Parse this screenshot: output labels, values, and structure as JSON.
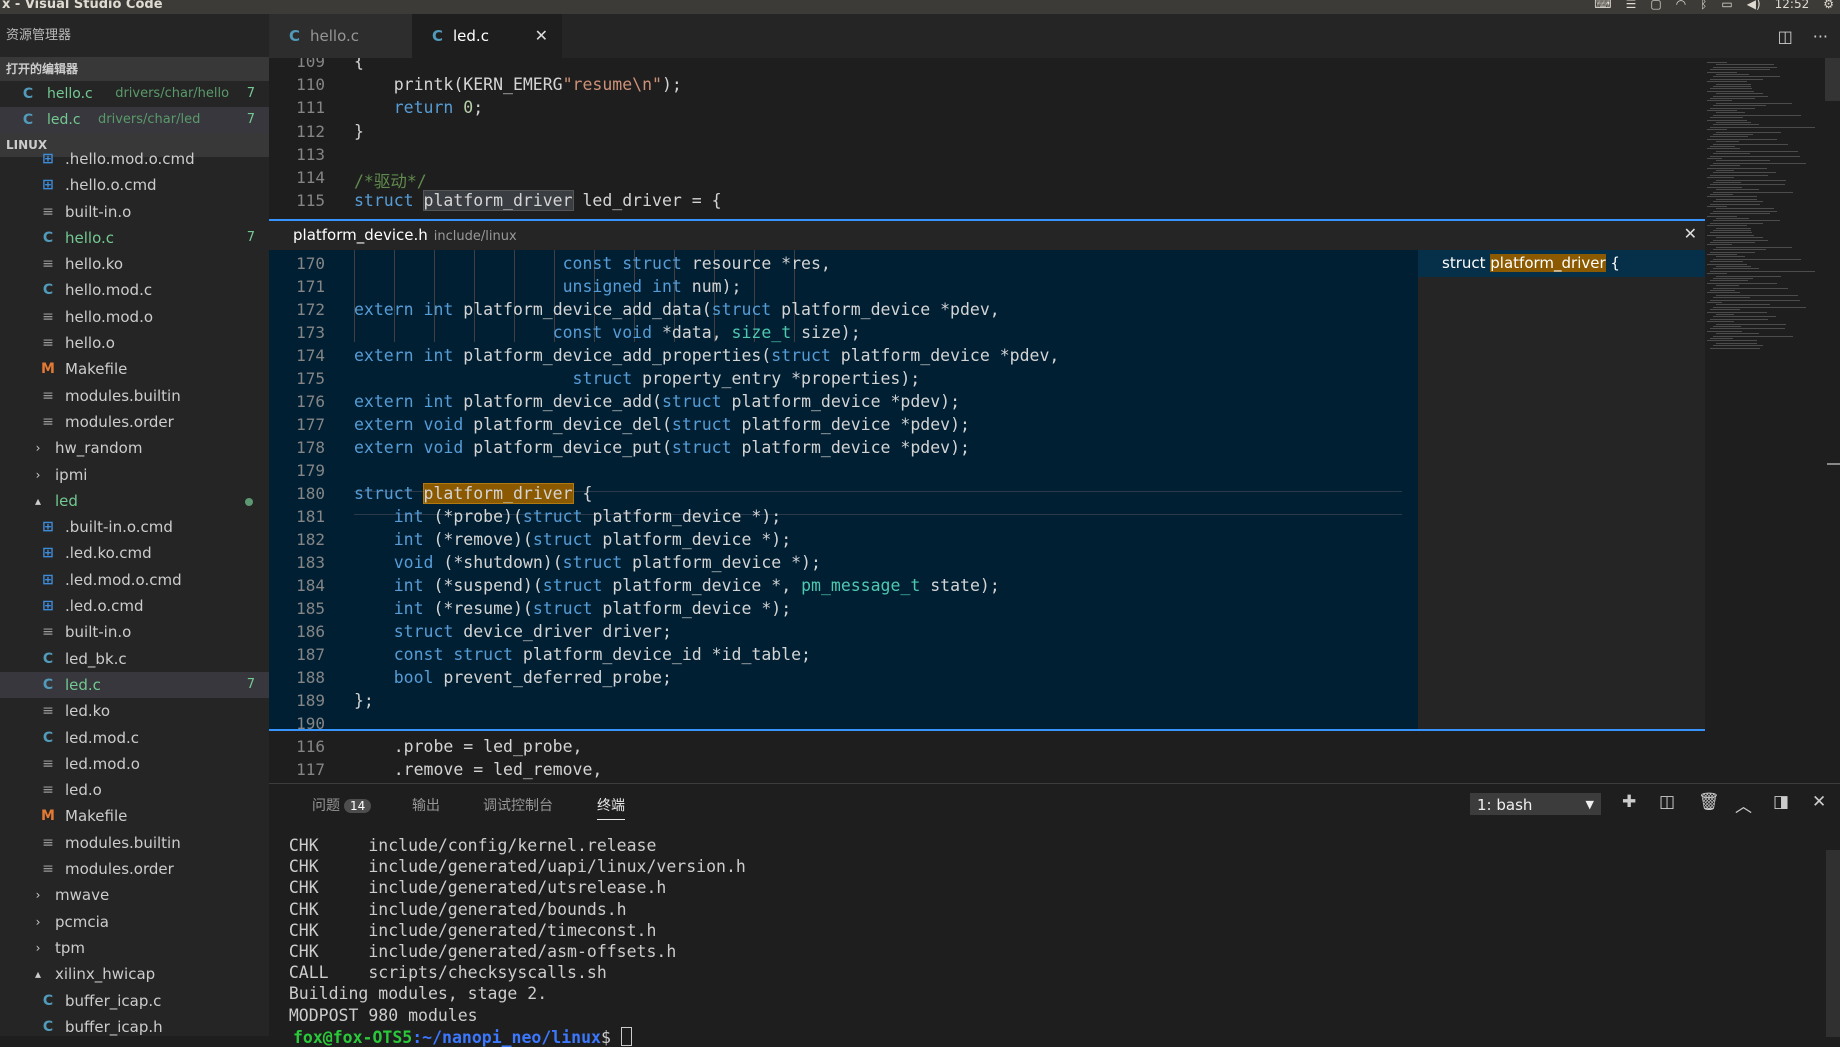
{
  "window": {
    "title": "x - Visual Studio Code",
    "clock": "12:52"
  },
  "sidebar": {
    "title": "资源管理器",
    "open_editors_label": "打开的编辑器",
    "open_editors": [
      {
        "icon": "C",
        "name": "hello.c",
        "path": "drivers/char/hello",
        "badge": "7"
      },
      {
        "icon": "C",
        "name": "led.c",
        "path": "drivers/char/led",
        "badge": "7"
      }
    ],
    "workspace_label": "LINUX",
    "tree": [
      {
        "icon": "win",
        "name": ".hello.mod.o.cmd",
        "indent": 2
      },
      {
        "icon": "win",
        "name": ".hello.o.cmd",
        "indent": 2
      },
      {
        "icon": "≡",
        "name": "built-in.o",
        "indent": 2
      },
      {
        "icon": "C",
        "name": "hello.c",
        "indent": 2,
        "badge": "7",
        "modified": true
      },
      {
        "icon": "≡",
        "name": "hello.ko",
        "indent": 2
      },
      {
        "icon": "C",
        "name": "hello.mod.c",
        "indent": 2
      },
      {
        "icon": "≡",
        "name": "hello.mod.o",
        "indent": 2
      },
      {
        "icon": "≡",
        "name": "hello.o",
        "indent": 2
      },
      {
        "icon": "M",
        "name": "Makefile",
        "indent": 2
      },
      {
        "icon": "≡",
        "name": "modules.builtin",
        "indent": 2
      },
      {
        "icon": "≡",
        "name": "modules.order",
        "indent": 2
      },
      {
        "icon": "›",
        "name": "hw_random",
        "indent": 1
      },
      {
        "icon": "›",
        "name": "ipmi",
        "indent": 1
      },
      {
        "icon": "⌄",
        "name": "led",
        "indent": 1,
        "modified": true,
        "dot": true
      },
      {
        "icon": "win",
        "name": ".built-in.o.cmd",
        "indent": 2
      },
      {
        "icon": "win",
        "name": ".led.ko.cmd",
        "indent": 2
      },
      {
        "icon": "win",
        "name": ".led.mod.o.cmd",
        "indent": 2
      },
      {
        "icon": "win",
        "name": ".led.o.cmd",
        "indent": 2
      },
      {
        "icon": "≡",
        "name": "built-in.o",
        "indent": 2
      },
      {
        "icon": "C",
        "name": "led_bk.c",
        "indent": 2
      },
      {
        "icon": "C",
        "name": "led.c",
        "indent": 2,
        "badge": "7",
        "modified": true,
        "selected": true
      },
      {
        "icon": "≡",
        "name": "led.ko",
        "indent": 2
      },
      {
        "icon": "C",
        "name": "led.mod.c",
        "indent": 2
      },
      {
        "icon": "≡",
        "name": "led.mod.o",
        "indent": 2
      },
      {
        "icon": "≡",
        "name": "led.o",
        "indent": 2
      },
      {
        "icon": "M",
        "name": "Makefile",
        "indent": 2
      },
      {
        "icon": "≡",
        "name": "modules.builtin",
        "indent": 2
      },
      {
        "icon": "≡",
        "name": "modules.order",
        "indent": 2
      },
      {
        "icon": "›",
        "name": "mwave",
        "indent": 1
      },
      {
        "icon": "›",
        "name": "pcmcia",
        "indent": 1
      },
      {
        "icon": "›",
        "name": "tpm",
        "indent": 1
      },
      {
        "icon": "⌄",
        "name": "xilinx_hwicap",
        "indent": 1
      },
      {
        "icon": "C",
        "name": "buffer_icap.c",
        "indent": 2
      },
      {
        "icon": "C",
        "name": "buffer_icap.h",
        "indent": 2
      }
    ]
  },
  "tabs": [
    {
      "label": "hello.c",
      "active": false
    },
    {
      "label": "led.c",
      "active": true
    }
  ],
  "editor": {
    "lines_top": [
      {
        "n": "109",
        "html": "{"
      },
      {
        "n": "110",
        "html": "    printk(KERN_EMERG<span class=\"str\">\"resume\\n\"</span>);"
      },
      {
        "n": "111",
        "html": "    <span class=\"kw\">return</span> <span class=\"num\">0</span>;"
      },
      {
        "n": "112",
        "html": "}"
      },
      {
        "n": "113",
        "html": ""
      },
      {
        "n": "114",
        "html": "<span class=\"cm\">/*驱动*/</span>"
      },
      {
        "n": "115",
        "html": "<span class=\"kw\">struct</span> <span class=\"hl\">platform_driver</span> led_driver = {"
      }
    ],
    "lines_bottom": [
      {
        "n": "116",
        "html": "    .probe = led_probe,"
      },
      {
        "n": "117",
        "html": "    .remove = led_remove,"
      }
    ]
  },
  "peek": {
    "file": "platform_device.h",
    "path": "include/linux",
    "reference": {
      "prefix": "struct ",
      "name": "platform_driver",
      "suffix": " {"
    },
    "lines": [
      {
        "n": "170",
        "html": "                     <span class=\"kw\">const</span> <span class=\"kw\">struct</span> resource *res,"
      },
      {
        "n": "171",
        "html": "                     <span class=\"kw\">unsigned</span> <span class=\"kw\">int</span> num);"
      },
      {
        "n": "172",
        "html": "<span class=\"kw\">extern</span> <span class=\"kw\">int</span> platform_device_add_data(<span class=\"kw\">struct</span> platform_device *pdev,"
      },
      {
        "n": "173",
        "html": "                    <span class=\"kw\">const</span> <span class=\"kw\">void</span> *data, <span class=\"ty\">size_t</span> size);"
      },
      {
        "n": "174",
        "html": "<span class=\"kw\">extern</span> <span class=\"kw\">int</span> platform_device_add_properties(<span class=\"kw\">struct</span> platform_device *pdev,"
      },
      {
        "n": "175",
        "html": "                      <span class=\"kw\">struct</span> property_entry *properties);"
      },
      {
        "n": "176",
        "html": "<span class=\"kw\">extern</span> <span class=\"kw\">int</span> platform_device_add(<span class=\"kw\">struct</span> platform_device *pdev);"
      },
      {
        "n": "177",
        "html": "<span class=\"kw\">extern</span> <span class=\"kw\">void</span> platform_device_del(<span class=\"kw\">struct</span> platform_device *pdev);"
      },
      {
        "n": "178",
        "html": "<span class=\"kw\">extern</span> <span class=\"kw\">void</span> platform_device_put(<span class=\"kw\">struct</span> platform_device *pdev);"
      },
      {
        "n": "179",
        "html": ""
      },
      {
        "n": "180",
        "html": "<span class=\"kw\">struct</span> <span class=\"hl2\">platform_driver</span> {"
      },
      {
        "n": "181",
        "html": "    <span class=\"kw\">int</span> (*probe)(<span class=\"kw\">struct</span> platform_device *);"
      },
      {
        "n": "182",
        "html": "    <span class=\"kw\">int</span> (*remove)(<span class=\"kw\">struct</span> platform_device *);"
      },
      {
        "n": "183",
        "html": "    <span class=\"kw\">void</span> (*shutdown)(<span class=\"kw\">struct</span> platform_device *);"
      },
      {
        "n": "184",
        "html": "    <span class=\"kw\">int</span> (*suspend)(<span class=\"kw\">struct</span> platform_device *, <span class=\"ty\">pm_message_t</span> state);"
      },
      {
        "n": "185",
        "html": "    <span class=\"kw\">int</span> (*resume)(<span class=\"kw\">struct</span> platform_device *);"
      },
      {
        "n": "186",
        "html": "    <span class=\"kw\">struct</span> device_driver driver;"
      },
      {
        "n": "187",
        "html": "    <span class=\"kw\">const</span> <span class=\"kw\">struct</span> platform_device_id *id_table;"
      },
      {
        "n": "188",
        "html": "    <span class=\"kw\">bool</span> prevent_deferred_probe;"
      },
      {
        "n": "189",
        "html": "};"
      },
      {
        "n": "190",
        "html": ""
      }
    ]
  },
  "panel": {
    "tabs": [
      {
        "label": "问题",
        "badge": "14"
      },
      {
        "label": "输出"
      },
      {
        "label": "调试控制台"
      },
      {
        "label": "终端",
        "active": true
      }
    ],
    "terminal_select": "1: bash",
    "terminal_lines": [
      "  CHK     include/config/kernel.release",
      "  CHK     include/generated/uapi/linux/version.h",
      "  CHK     include/generated/utsrelease.h",
      "  CHK     include/generated/bounds.h",
      "  CHK     include/generated/timeconst.h",
      "  CHK     include/generated/asm-offsets.h",
      "  CALL    scripts/checksyscalls.sh",
      "  Building modules, stage 2.",
      "  MODPOST 980 modules"
    ],
    "prompt_user": "fox@fox-OTS5",
    "prompt_path": ":~/nanopi_neo/linux",
    "prompt_symbol": "$ "
  },
  "colors": {
    "accent": "#3794ff",
    "peek_bg": "#001f33",
    "modified": "#73c991"
  }
}
